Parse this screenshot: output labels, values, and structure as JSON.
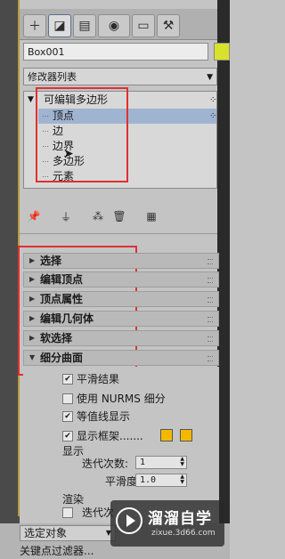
{
  "colors": {
    "accent_red": "#e03030",
    "selection": "#9fb4d0",
    "swatch": "#f5b800",
    "object_color": "#d9e22a"
  },
  "tabs": [
    {
      "icon": "create-icon"
    },
    {
      "icon": "modify-icon"
    },
    {
      "icon": "hierarchy-icon"
    },
    {
      "icon": "motion-icon"
    },
    {
      "icon": "display-icon"
    },
    {
      "icon": "utilities-icon"
    }
  ],
  "object_name": "Box001",
  "modifier_list": "修改器列表",
  "stack": {
    "root": "可编辑多边形",
    "items": [
      "顶点",
      "边",
      "边界",
      "多边形",
      "元素"
    ],
    "selected": "顶点"
  },
  "toolbar": {
    "icons": [
      "pin-stack-icon",
      "show-end-result-icon",
      "make-unique-icon",
      "remove-modifier-icon",
      "configure-sets-icon"
    ]
  },
  "rollouts": [
    "选择",
    "编辑顶点",
    "顶点属性",
    "编辑几何体",
    "软选择",
    "细分曲面"
  ],
  "subdiv": {
    "smooth_result": "平滑结果",
    "use_nurms": "使用 NURMS 细分",
    "isoline": "等值线显示",
    "show_cage": "显示框架.......",
    "display_label": "显示",
    "iterations_label": "迭代次数:",
    "iterations_value": "1",
    "smoothness_label": "平滑度:",
    "smoothness_value": "1.0",
    "render_label": "渲染",
    "render_iter_label": "迭代次"
  },
  "bottom": {
    "selection_set": "选定对象",
    "key_filter": "关键点过滤器..."
  },
  "watermark": {
    "brand": "溜溜自学",
    "url": "zixue.3d66.com"
  }
}
